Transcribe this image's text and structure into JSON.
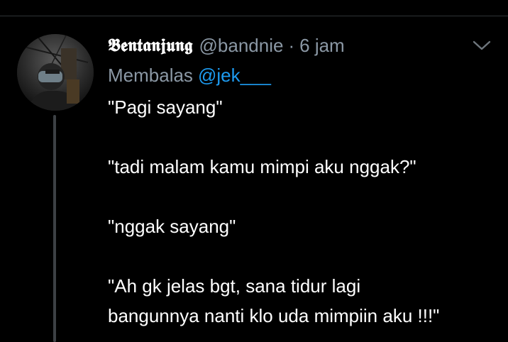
{
  "tweet": {
    "author": {
      "display_name": "𝕭𝖊𝖓𝖙𝖆𝖓𝖏𝖚𝖓𝖌",
      "handle": "@bandnie",
      "avatar_icon": "profile-photo-icon"
    },
    "separator": "·",
    "time": "6 jam",
    "reply": {
      "prefix": "Membalas",
      "mention": "@jek___"
    },
    "menu_icon": "chevron-down-icon",
    "lines": [
      "\"Pagi sayang\"",
      "",
      "\"tadi malam kamu mimpi aku nggak?\"",
      "",
      "\"nggak sayang\"",
      "",
      "\"Ah gk jelas bgt, sana tidur lagi",
      "bangunnya nanti klo uda mimpiin aku !!!\""
    ]
  },
  "colors": {
    "background": "#000000",
    "text_primary": "#ffffff",
    "text_secondary": "#8b98a5",
    "accent": "#1d9bf0",
    "thread_line": "#3d4145"
  }
}
